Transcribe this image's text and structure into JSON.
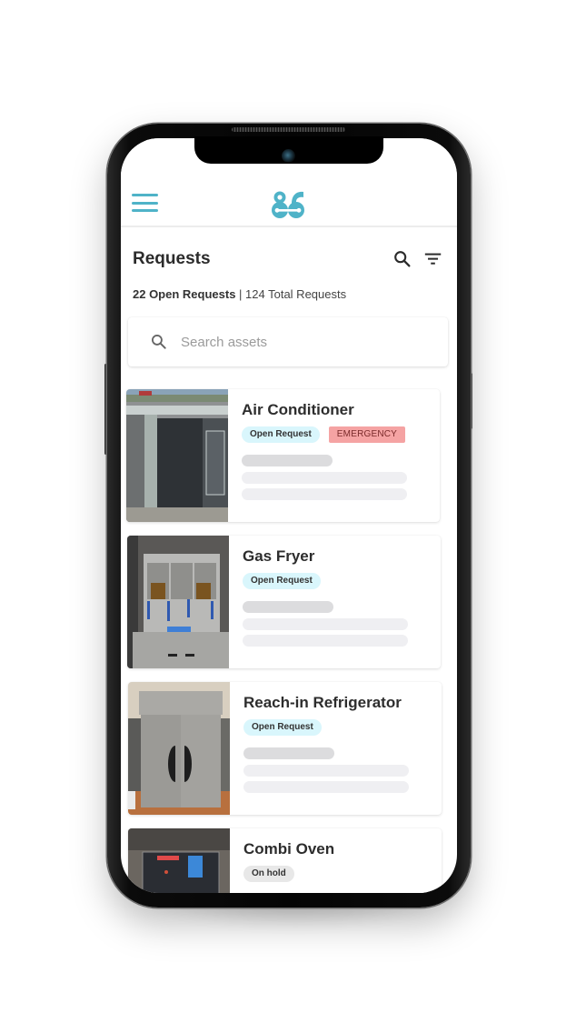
{
  "app": {
    "logo_text": "86",
    "brand_color": "#4fb3c8"
  },
  "header": {
    "menu_icon": "hamburger-menu-icon",
    "title": "Requests",
    "search_icon": "search-icon",
    "filter_icon": "filter-icon"
  },
  "summary": {
    "open_label": "22 Open Requests",
    "separator": " | ",
    "total_label": "124 Total Requests"
  },
  "search": {
    "placeholder": "Search assets",
    "value": ""
  },
  "requests": [
    {
      "name": "Air Conditioner",
      "badges": [
        {
          "label": "Open Request",
          "type": "open"
        },
        {
          "label": "EMERGENCY",
          "type": "emergency"
        }
      ],
      "image": "rooftop-hvac-unit"
    },
    {
      "name": "Gas Fryer",
      "badges": [
        {
          "label": "Open Request",
          "type": "open"
        }
      ],
      "image": "stainless-fryer"
    },
    {
      "name": "Reach-in Refrigerator",
      "badges": [
        {
          "label": "Open Request",
          "type": "open"
        }
      ],
      "image": "stainless-refrigerator"
    },
    {
      "name": "Combi Oven",
      "badges": [
        {
          "label": "On hold",
          "type": "hold"
        }
      ],
      "image": "combi-oven"
    }
  ],
  "colors": {
    "open_badge": "#d9f6fc",
    "emergency_badge": "#f5a3a3",
    "hold_badge": "#e8e8e8",
    "skeleton_dark": "#dcdcde",
    "skeleton_light": "#efeff2"
  }
}
